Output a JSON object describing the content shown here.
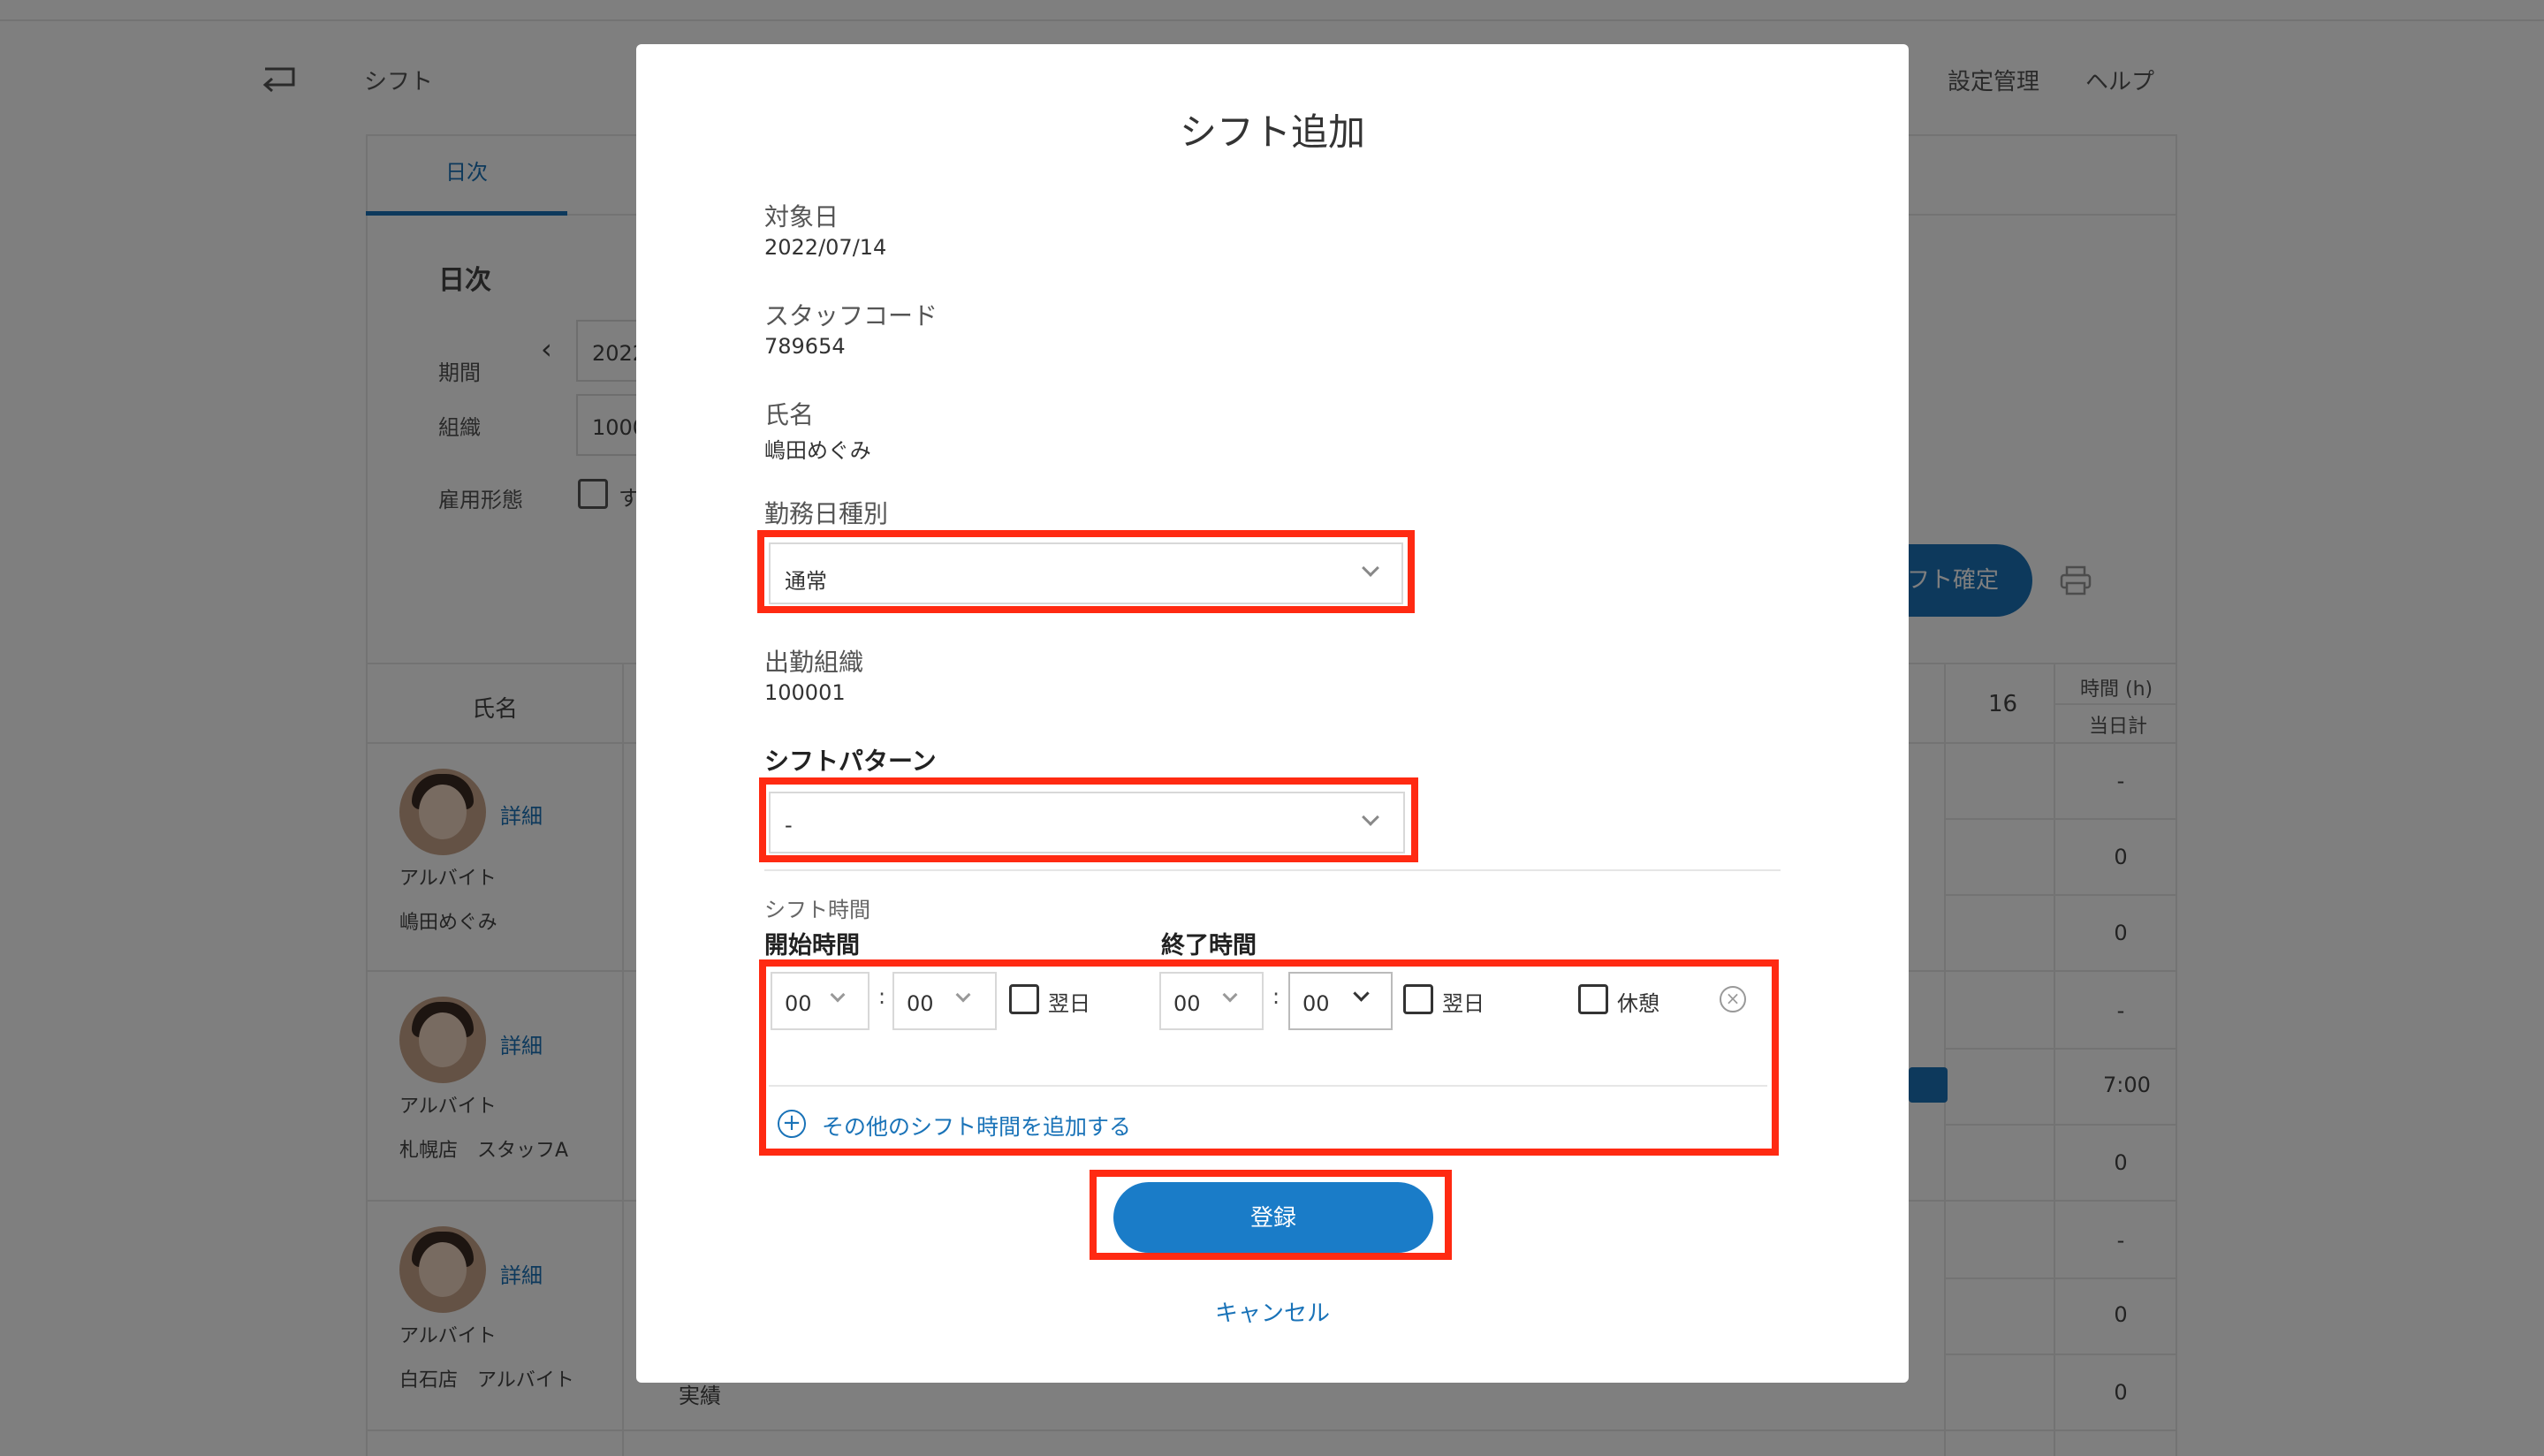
{
  "background": {
    "header": {
      "title": "シフト",
      "nav": [
        "設定管理",
        "ヘルプ"
      ]
    },
    "tab": "日次",
    "section_title": "日次",
    "filters": {
      "period_label": "期間",
      "period_value": "2022",
      "org_label": "組織",
      "org_value": "1000",
      "employment_label": "雇用形態",
      "employment_check_text": "す"
    },
    "confirm_button": "フト確定",
    "table": {
      "name_header": "氏名",
      "day_header": "16",
      "hours_header": "時間 (h)",
      "daytotal_header": "当日計",
      "totals": [
        "-",
        "0",
        "0",
        "-",
        "7:00",
        "0",
        "-",
        "0",
        "0"
      ],
      "employees": [
        {
          "detail": "詳細",
          "type": "アルバイト",
          "name": "嶋田めぐみ"
        },
        {
          "detail": "詳細",
          "type": "アルバイト",
          "name": "札幌店　スタッフA"
        },
        {
          "detail": "詳細",
          "type": "アルバイト",
          "name": "白石店　アルバイト"
        }
      ],
      "actual_label": "実績"
    }
  },
  "modal": {
    "title": "シフト追加",
    "target_date": {
      "label": "対象日",
      "value": "2022/07/14"
    },
    "staff_code": {
      "label": "スタッフコード",
      "value": "789654"
    },
    "name": {
      "label": "氏名",
      "value": "嶋田めぐみ"
    },
    "workday_type": {
      "label": "勤務日種別",
      "value": "通常"
    },
    "work_org": {
      "label": "出勤組織",
      "value": "100001"
    },
    "shift_pattern": {
      "label": "シフトパターン",
      "value": "-"
    },
    "shift_time": {
      "label": "シフト時間",
      "start_label": "開始時間",
      "end_label": "終了時間",
      "start_hour": "00",
      "start_min": "00",
      "end_hour": "00",
      "end_min": "00",
      "colon": ":",
      "next_day_label": "翌日",
      "break_label": "休憩",
      "add_link": "その他のシフト時間を追加する"
    },
    "submit_label": "登録",
    "cancel_label": "キャンセル"
  },
  "colors": {
    "accent": "#1a73b8",
    "highlight": "#ff2a12"
  }
}
